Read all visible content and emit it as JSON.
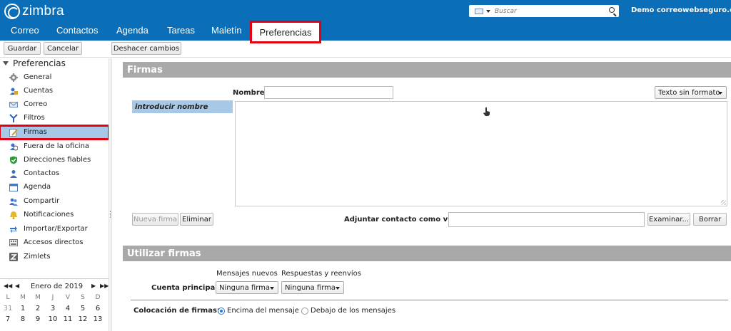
{
  "header": {
    "logo_text": "zimbra",
    "search_placeholder": "Buscar",
    "user": "Demo correowebseguro.co"
  },
  "tabs": [
    {
      "label": "Correo"
    },
    {
      "label": "Contactos"
    },
    {
      "label": "Agenda"
    },
    {
      "label": "Tareas"
    },
    {
      "label": "Maletín"
    },
    {
      "label": "Preferencias",
      "active": true
    }
  ],
  "toolbar": {
    "save": "Guardar",
    "cancel": "Cancelar",
    "undo": "Deshacer cambios"
  },
  "sidebar": {
    "heading": "Preferencias",
    "items": [
      {
        "label": "General",
        "icon": "gear-icon"
      },
      {
        "label": "Cuentas",
        "icon": "accounts-icon"
      },
      {
        "label": "Correo",
        "icon": "mail-icon"
      },
      {
        "label": "Filtros",
        "icon": "filter-icon"
      },
      {
        "label": "Firmas",
        "icon": "signature-icon",
        "selected": true
      },
      {
        "label": "Fuera de la oficina",
        "icon": "out-of-office-icon"
      },
      {
        "label": "Direcciones fiables",
        "icon": "shield-icon"
      },
      {
        "label": "Contactos",
        "icon": "contact-icon"
      },
      {
        "label": "Agenda",
        "icon": "calendar-icon"
      },
      {
        "label": "Compartir",
        "icon": "share-icon"
      },
      {
        "label": "Notificaciones",
        "icon": "bell-icon"
      },
      {
        "label": "Importar/Exportar",
        "icon": "import-export-icon"
      },
      {
        "label": "Accesos directos",
        "icon": "shortcuts-icon"
      },
      {
        "label": "Zimlets",
        "icon": "zimlet-icon"
      }
    ]
  },
  "calendar": {
    "month": "Enero de 2019",
    "dow": [
      "L",
      "M",
      "M",
      "J",
      "V",
      "S",
      "D"
    ],
    "weeks": [
      [
        "31",
        "1",
        "2",
        "3",
        "4",
        "5",
        "6"
      ],
      [
        "7",
        "8",
        "9",
        "10",
        "11",
        "12",
        "13"
      ]
    ]
  },
  "firmas": {
    "title": "Firmas",
    "name_label": "Nombre:",
    "name_value": "",
    "format": "Texto sin formato",
    "list_item": "introducir nombre",
    "new_button": "Nueva firma",
    "delete_button": "Eliminar",
    "vcard_label": "Adjuntar contacto como vCard:",
    "vcard_value": "",
    "browse_button": "Examinar...",
    "clear_button": "Borrar"
  },
  "usar": {
    "title": "Utilizar firmas",
    "col_new": "Mensajes nuevos",
    "col_reply": "Respuestas y reenvíos",
    "account_label": "Cuenta principal:",
    "new_value": "Ninguna firma",
    "reply_value": "Ninguna firma",
    "placement_label": "Colocación de firmas:",
    "option_above": "Encima del mensaje",
    "option_below": "Debajo de los mensajes",
    "selected_option": "above"
  },
  "colors": {
    "brand": "#0a6fb8",
    "highlight": "#e3000f",
    "selection": "#a7c8e6",
    "section_bar": "#a9a9a9"
  }
}
